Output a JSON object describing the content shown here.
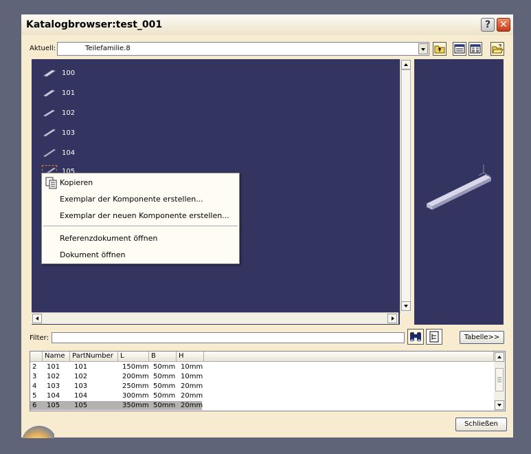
{
  "window": {
    "title": "Katalogbrowser:test_001",
    "help_label": "?",
    "close_label": "✕"
  },
  "current": {
    "label": "Aktuell:",
    "value": "Teilefamilie.8"
  },
  "catalog_items": [
    {
      "label": "100"
    },
    {
      "label": "101"
    },
    {
      "label": "102"
    },
    {
      "label": "103"
    },
    {
      "label": "104"
    },
    {
      "label": "105"
    }
  ],
  "context_menu": {
    "items": [
      {
        "label": "Kopieren"
      },
      {
        "label": "Exemplar der Komponente erstellen..."
      },
      {
        "label": "Exemplar der neuen Komponente erstellen..."
      },
      {
        "label": "Referenzdokument öffnen"
      },
      {
        "label": "Dokument öffnen"
      }
    ]
  },
  "filter": {
    "label": "Filter:",
    "value": ""
  },
  "buttons": {
    "table_label": "Tabelle>>",
    "close_label": "Schließen"
  },
  "table": {
    "columns": [
      "Name",
      "PartNumber",
      "L",
      "B",
      "H"
    ],
    "rows": [
      {
        "index": "2",
        "name": "101",
        "partnumber": "101",
        "l": "150mm",
        "b": "50mm",
        "h": "10mm"
      },
      {
        "index": "3",
        "name": "102",
        "partnumber": "102",
        "l": "200mm",
        "b": "50mm",
        "h": "10mm"
      },
      {
        "index": "4",
        "name": "103",
        "partnumber": "103",
        "l": "250mm",
        "b": "50mm",
        "h": "20mm"
      },
      {
        "index": "5",
        "name": "104",
        "partnumber": "104",
        "l": "300mm",
        "b": "50mm",
        "h": "20mm"
      },
      {
        "index": "6",
        "name": "105",
        "partnumber": "105",
        "l": "350mm",
        "b": "50mm",
        "h": "20mm"
      }
    ],
    "selected_row": 4
  },
  "colors": {
    "viewer_background": "#33345f",
    "dialog_background": "#f8ecd0",
    "selection": "#b4b2b0"
  }
}
